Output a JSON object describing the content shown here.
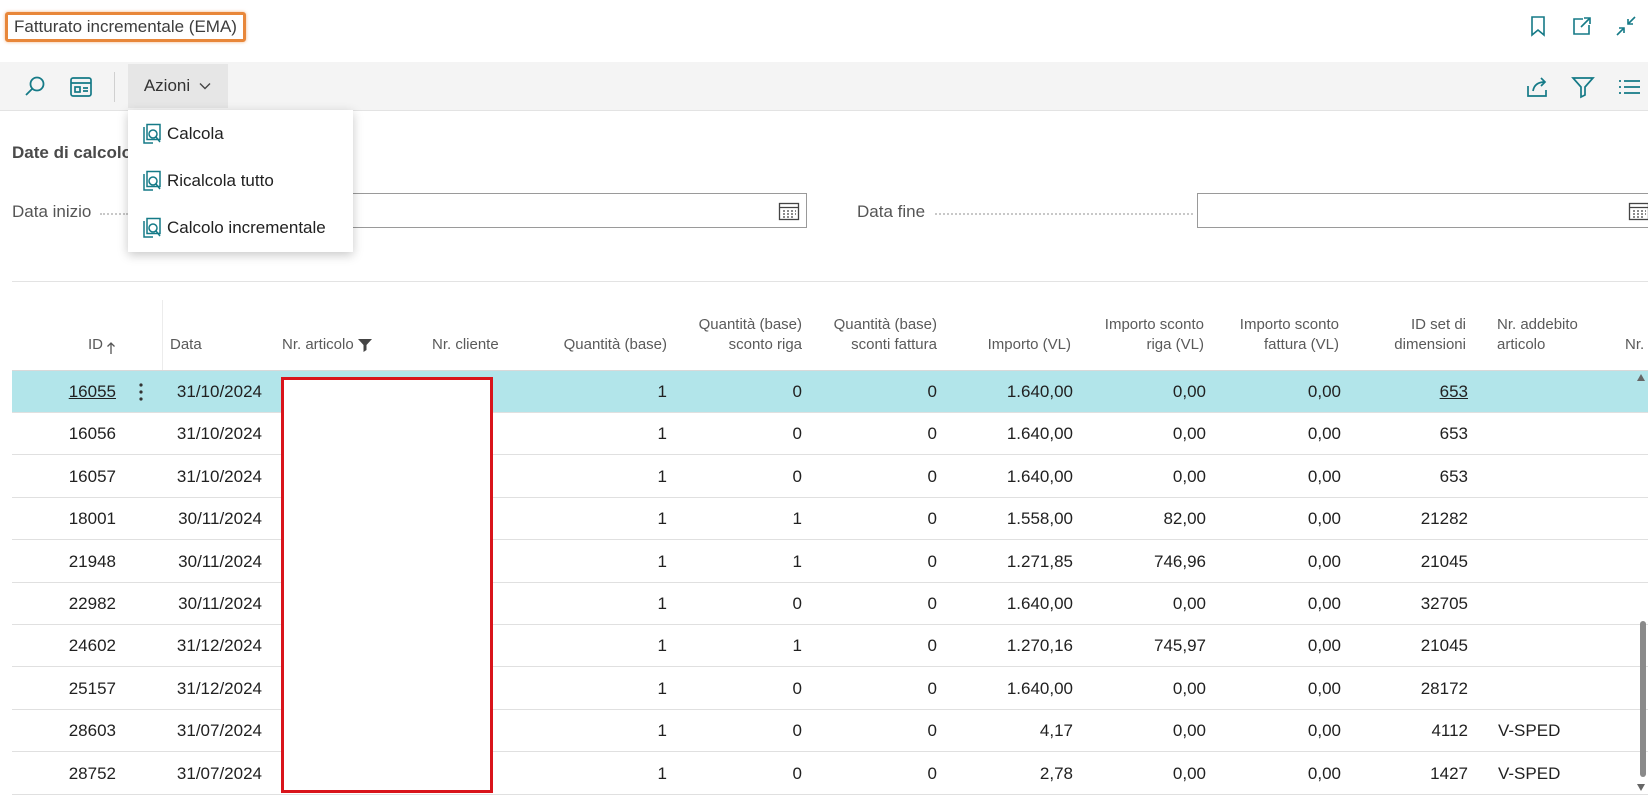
{
  "window": {
    "title": "Fatturato incrementale (EMA)",
    "icons": [
      "bookmark-icon",
      "open-in-new-window-icon",
      "collapse-icon"
    ]
  },
  "actionbar": {
    "icons": [
      "search-icon",
      "layout-icon",
      "share-icon",
      "filter-icon",
      "list-view-icon"
    ],
    "actions_label": "Azioni"
  },
  "menu": {
    "items": [
      {
        "label": "Calcola",
        "icon": "calculate-icon"
      },
      {
        "label": "Ricalcola tutto",
        "icon": "calculate-icon"
      },
      {
        "label": "Calcolo incrementale",
        "icon": "calculate-icon"
      }
    ]
  },
  "filters": {
    "section_title": "Date di calcolo",
    "start_label": "Data inizio",
    "start_value": "",
    "end_label": "Data fine",
    "end_value": ""
  },
  "table": {
    "columns": [
      {
        "label": "ID",
        "sort": "ascending"
      },
      {
        "label": "Data"
      },
      {
        "label": "Nr. articolo",
        "filtered": true
      },
      {
        "label": "Nr. cliente"
      },
      {
        "label": "Quantità (base)"
      },
      {
        "label": "Quantità (base) sconto riga"
      },
      {
        "label": "Quantità (base) sconti fattura"
      },
      {
        "label": "Importo (VL)"
      },
      {
        "label": "Importo sconto riga (VL)"
      },
      {
        "label": "Importo sconto fattura (VL)"
      },
      {
        "label": "ID set di dimensioni"
      },
      {
        "label": "Nr. addebito articolo"
      },
      {
        "label": "Nr."
      }
    ],
    "header_lines": {
      "id": "ID",
      "data": "Data",
      "articolo": "Nr. articolo",
      "cliente": "Nr. cliente",
      "qty": "Quantità (base)",
      "qty_riga_1": "Quantità (base)",
      "qty_riga_2": "sconto riga",
      "qty_fatt_1": "Quantità (base)",
      "qty_fatt_2": "sconti fattura",
      "importo": "Importo (VL)",
      "sc_riga_1": "Importo sconto",
      "sc_riga_2": "riga (VL)",
      "sc_fatt_1": "Importo sconto",
      "sc_fatt_2": "fattura (VL)",
      "dim_1": "ID set di",
      "dim_2": "dimensioni",
      "add_1": "Nr. addebito",
      "add_2": "articolo",
      "nr": "Nr."
    },
    "rows": [
      {
        "id": "16055",
        "data": "31/10/2024",
        "qty": "1",
        "qty_riga": "0",
        "qty_fatt": "0",
        "importo": "1.640,00",
        "sc_riga": "0,00",
        "sc_fatt": "0,00",
        "dim": "653",
        "addebito": "",
        "selected": true
      },
      {
        "id": "16056",
        "data": "31/10/2024",
        "qty": "1",
        "qty_riga": "0",
        "qty_fatt": "0",
        "importo": "1.640,00",
        "sc_riga": "0,00",
        "sc_fatt": "0,00",
        "dim": "653",
        "addebito": ""
      },
      {
        "id": "16057",
        "data": "31/10/2024",
        "qty": "1",
        "qty_riga": "0",
        "qty_fatt": "0",
        "importo": "1.640,00",
        "sc_riga": "0,00",
        "sc_fatt": "0,00",
        "dim": "653",
        "addebito": ""
      },
      {
        "id": "18001",
        "data": "30/11/2024",
        "qty": "1",
        "qty_riga": "1",
        "qty_fatt": "0",
        "importo": "1.558,00",
        "sc_riga": "82,00",
        "sc_fatt": "0,00",
        "dim": "21282",
        "addebito": ""
      },
      {
        "id": "21948",
        "data": "30/11/2024",
        "qty": "1",
        "qty_riga": "1",
        "qty_fatt": "0",
        "importo": "1.271,85",
        "sc_riga": "746,96",
        "sc_fatt": "0,00",
        "dim": "21045",
        "addebito": ""
      },
      {
        "id": "22982",
        "data": "30/11/2024",
        "qty": "1",
        "qty_riga": "0",
        "qty_fatt": "0",
        "importo": "1.640,00",
        "sc_riga": "0,00",
        "sc_fatt": "0,00",
        "dim": "32705",
        "addebito": ""
      },
      {
        "id": "24602",
        "data": "31/12/2024",
        "qty": "1",
        "qty_riga": "1",
        "qty_fatt": "0",
        "importo": "1.270,16",
        "sc_riga": "745,97",
        "sc_fatt": "0,00",
        "dim": "21045",
        "addebito": ""
      },
      {
        "id": "25157",
        "data": "31/12/2024",
        "qty": "1",
        "qty_riga": "0",
        "qty_fatt": "0",
        "importo": "1.640,00",
        "sc_riga": "0,00",
        "sc_fatt": "0,00",
        "dim": "28172",
        "addebito": ""
      },
      {
        "id": "28603",
        "data": "31/07/2024",
        "qty": "1",
        "qty_riga": "0",
        "qty_fatt": "0",
        "importo": "4,17",
        "sc_riga": "0,00",
        "sc_fatt": "0,00",
        "dim": "4112",
        "addebito": "V-SPED"
      },
      {
        "id": "28752",
        "data": "31/07/2024",
        "qty": "1",
        "qty_riga": "0",
        "qty_fatt": "0",
        "importo": "2,78",
        "sc_riga": "0,00",
        "sc_fatt": "0,00",
        "dim": "1427",
        "addebito": "V-SPED"
      }
    ]
  },
  "colors": {
    "accent": "#157a87",
    "selected_row": "#b2e5ea",
    "title_highlight": "#e8873a",
    "redaction_border": "#d9141b"
  }
}
